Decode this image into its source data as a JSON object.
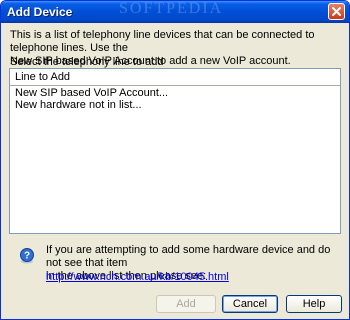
{
  "window": {
    "title": "Add Device",
    "watermark": "SOFTPEDIA"
  },
  "description": "This is a list of telephony line devices that can be connected to telephone lines. Use the\nNew SIP based VoIP Account to add a new VoIP account.",
  "select_label": "Select the telephony line to add",
  "list": {
    "header": "Line to Add",
    "items": [
      "New SIP based VoIP Account...",
      "New hardware not in list..."
    ]
  },
  "info": {
    "text": "If you are attempting to add some hardware device and do not see that item\nin the above list then please see:",
    "link": "http://www.nch.com.au/kb/10045.html"
  },
  "buttons": {
    "add": "Add",
    "cancel": "Cancel",
    "help": "Help"
  },
  "colors": {
    "titlebar": "#0050d8",
    "dialog_bg": "#ece9d8",
    "link": "#0000ee"
  }
}
